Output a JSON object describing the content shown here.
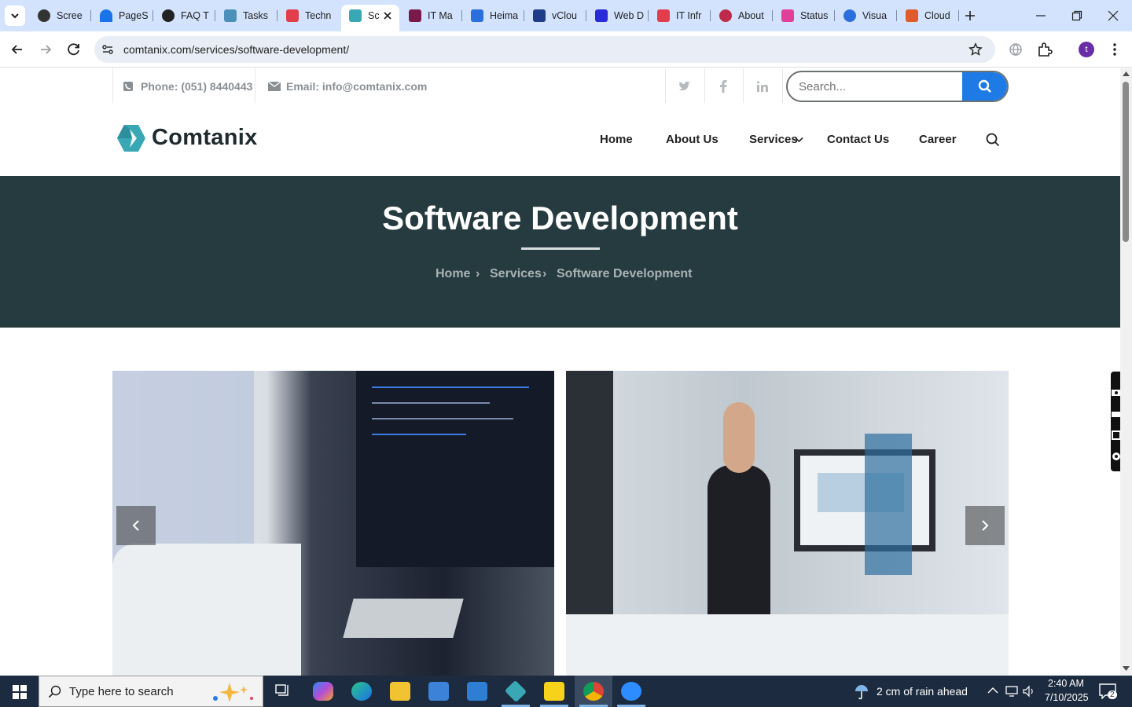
{
  "browser": {
    "tabs": [
      {
        "label": "Scree",
        "color": "#333333"
      },
      {
        "label": "PageS",
        "color": "#1a73e8"
      },
      {
        "label": "FAQ T",
        "color": "#222222"
      },
      {
        "label": "Tasks",
        "color": "#4a90b8"
      },
      {
        "label": "Techn",
        "color": "#e23d4b"
      },
      {
        "label": "Sc",
        "color": "#3aa7b5"
      },
      {
        "label": "IT Ma",
        "color": "#7a1a4a"
      },
      {
        "label": "Heima",
        "color": "#2a6fdb"
      },
      {
        "label": "vClou",
        "color": "#1f3c88"
      },
      {
        "label": "Web D",
        "color": "#2a2ad8"
      },
      {
        "label": "IT Infr",
        "color": "#e23d4b"
      },
      {
        "label": "About",
        "color": "#c02a4a"
      },
      {
        "label": "Status",
        "color": "#e0409a"
      },
      {
        "label": "Visua",
        "color": "#2a6fdb"
      },
      {
        "label": "Cloud",
        "color": "#e05a2a"
      }
    ],
    "url": "comtanix.com/services/software-development/",
    "profile_initial": "t"
  },
  "site": {
    "phone": "Phone: (051) 8440443",
    "email": "Email: info@comtanix.com",
    "search_placeholder": "Search...",
    "logo_text": "Comtanix",
    "nav": {
      "home": "Home",
      "about": "About Us",
      "services": "Services",
      "contact": "Contact Us",
      "career": "Career"
    },
    "hero": {
      "title": "Software Development",
      "crumb_home": "Home",
      "crumb_services": "Services",
      "crumb_current": "Software Development",
      "crumb_sep": "›"
    },
    "colors": {
      "hero_bg": "#263b3f",
      "search_btn": "#1e7be6",
      "logo_teal": "#3aa7b5"
    }
  },
  "taskbar": {
    "search_placeholder": "Type here to search",
    "weather": "2 cm of rain ahead",
    "time": "2:40 AM",
    "date": "7/10/2025",
    "notification_count": "2"
  }
}
